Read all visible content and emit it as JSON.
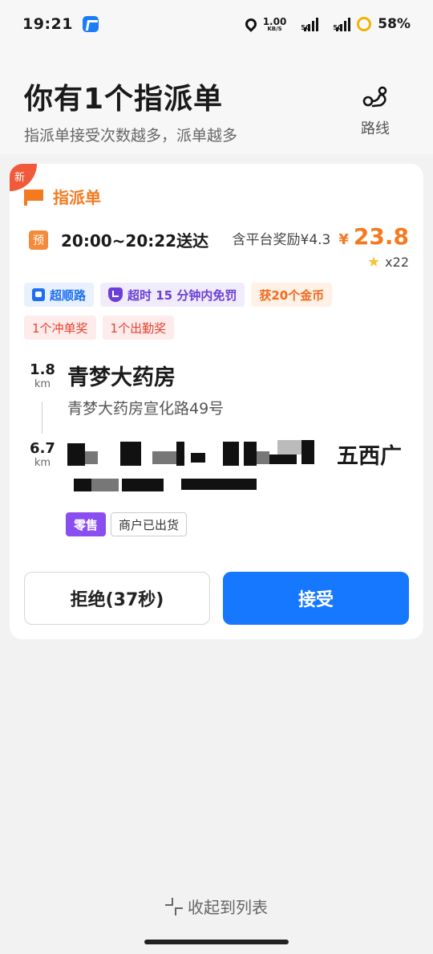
{
  "status_bar": {
    "time": "19:21",
    "speed_value": "1.00",
    "speed_unit": "KB/S",
    "net1": "5G",
    "net2": "5G",
    "battery": "58%"
  },
  "header": {
    "title": "你有1个指派单",
    "subtitle": "指派单接受次数越多，派单越多",
    "route_label": "路线"
  },
  "order": {
    "new_tag": "新",
    "type_label": "指派单",
    "pre_badge": "预",
    "delivery_time": "20:00~20:22送达",
    "reward_label": "含平台奖励¥4.3",
    "price_symbol": "¥",
    "price": "23.8",
    "stars": "x22",
    "tags": [
      {
        "label": "超顺路"
      },
      {
        "label": "超时 15 分钟内免罚"
      },
      {
        "label": "获20个金币"
      }
    ],
    "bonus_tags": [
      {
        "label": "1个冲单奖"
      },
      {
        "label": "1个出勤奖"
      }
    ],
    "pickup": {
      "distance": "1.8",
      "unit": "km",
      "name": "青梦大药房",
      "address": "青梦大药房宣化路49号"
    },
    "dropoff": {
      "distance": "6.7",
      "unit": "km",
      "name_visible_tail": "五西广"
    },
    "badges": {
      "retail": "零售",
      "shipped": "商户已出货"
    },
    "reject_label": "拒绝(37秒)",
    "accept_label": "接受"
  },
  "footer": {
    "collapse_label": "收起到列表"
  },
  "colors": {
    "accent_blue": "#1677ff",
    "orange": "#f47a20",
    "purple": "#8a4ef0"
  }
}
